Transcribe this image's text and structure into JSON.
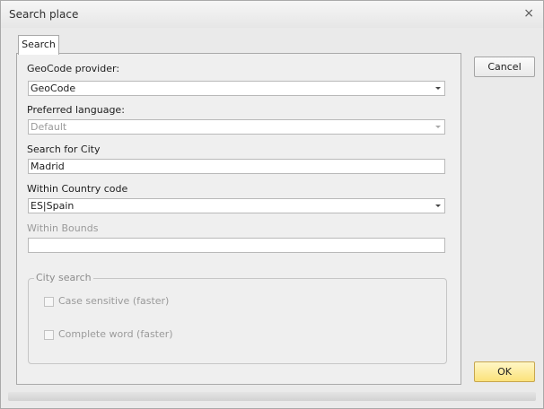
{
  "window": {
    "title": "Search place",
    "close_glyph": "×"
  },
  "tabs": [
    {
      "label": "Search",
      "selected": true
    }
  ],
  "form": {
    "geocode_provider": {
      "label": "GeoCode provider:",
      "value": "GeoCode"
    },
    "preferred_language": {
      "label": "Preferred language:",
      "value": "Default",
      "disabled": true
    },
    "search_city": {
      "label": "Search for City",
      "value": "Madrid"
    },
    "country_code": {
      "label": "Within Country code",
      "value": "ES|Spain"
    },
    "within_bounds": {
      "label": "Within Bounds",
      "value": "",
      "disabled": true
    }
  },
  "city_search": {
    "title": "City search",
    "options": [
      {
        "label": "Case sensitive (faster)",
        "checked": false,
        "disabled": true
      },
      {
        "label": "Complete word (faster)",
        "checked": false,
        "disabled": true
      }
    ]
  },
  "buttons": {
    "cancel": "Cancel",
    "ok": "OK"
  },
  "colors": {
    "ok_button": "#fbe27a",
    "dialog_bg": "#eaeaea"
  }
}
